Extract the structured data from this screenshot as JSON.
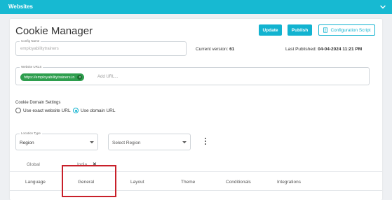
{
  "topbar": {
    "title": "Websites",
    "chevron_icon": "chevron-down-icon"
  },
  "header": {
    "title": "Cookie Manager",
    "update_label": "Update",
    "publish_label": "Publish",
    "config_script_label": "Configuration Script"
  },
  "config": {
    "label": "Config Name",
    "value": "employabilitytrainers",
    "version_label": "Current version:",
    "version_value": "61",
    "published_label": "Last Published:",
    "published_value": "04-04-2024 11:21 PM"
  },
  "urls": {
    "label": "Website URLS",
    "chips": [
      "https://employabilitytrainers.in"
    ],
    "placeholder": "Add URL..."
  },
  "domain": {
    "title": "Cookie Domain Settings",
    "options": [
      "Use exact website URL",
      "Use domain URL"
    ],
    "selected": "Use domain URL"
  },
  "location": {
    "type_label": "Location Type",
    "type_value": "Region",
    "region_placeholder": "Select Region"
  },
  "region_tabs": [
    "Global",
    "India"
  ],
  "section_tabs": [
    "Language",
    "General",
    "Layout",
    "Theme",
    "Conditionals",
    "Integrations"
  ],
  "colors": {
    "accent": "#12b3d0",
    "header": "#17b9d2",
    "chip": "#2e9e4e",
    "highlight": "#c8202a"
  }
}
